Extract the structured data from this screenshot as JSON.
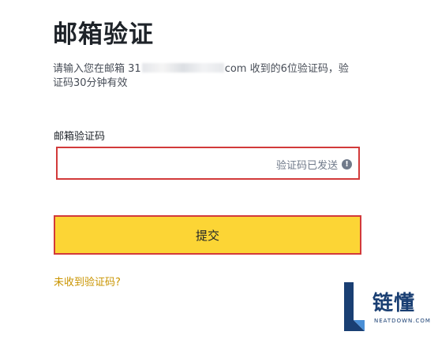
{
  "page": {
    "title": "邮箱验证",
    "description_prefix": "请输入您在邮箱 31",
    "description_suffix": "com 收到的6位验证码，验",
    "description_line2": "证码30分钟有效"
  },
  "form": {
    "code_label": "邮箱验证码",
    "code_value": "",
    "code_placeholder": "",
    "sent_hint": "验证码已发送",
    "warning_icon": "!",
    "submit_label": "提交",
    "resend_link": "未收到验证码?"
  },
  "watermark": {
    "text": "链懂",
    "subtext": "NEATDOWN.COM"
  },
  "colors": {
    "accent_yellow": "#fcd535",
    "highlight_red": "#d23a3a",
    "link_gold": "#c99400",
    "watermark_blue": "#1a3f73"
  }
}
